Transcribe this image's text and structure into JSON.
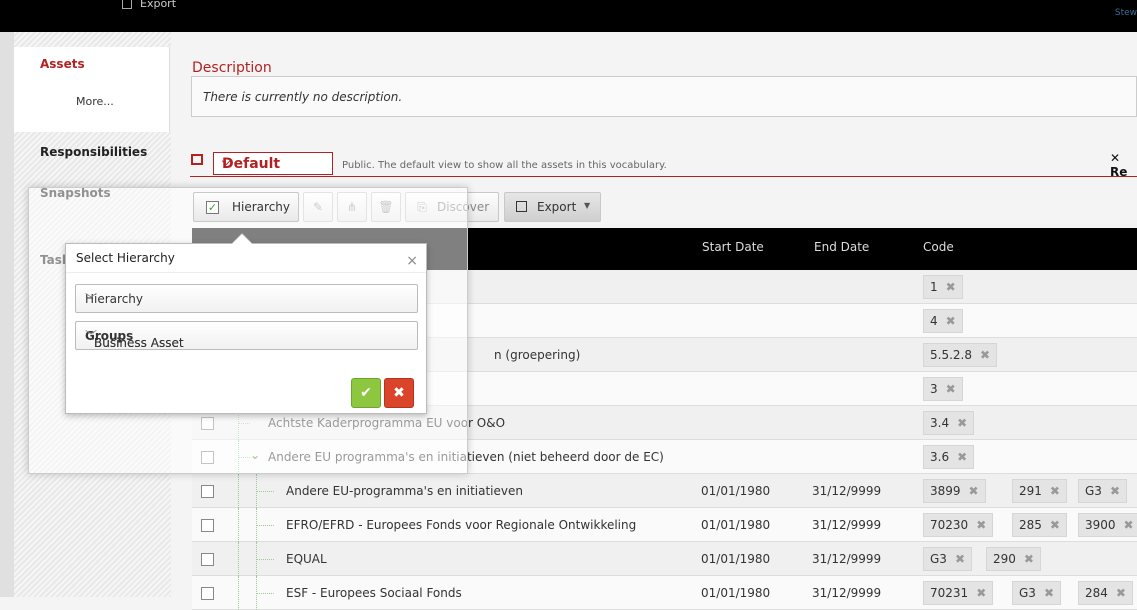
{
  "topbar": {
    "export_label": "Export",
    "user_label": "Stew"
  },
  "nav": {
    "assets": "Assets",
    "more": "More...",
    "responsibilities": "Responsibilities",
    "snapshots": "Snapshots",
    "tasks": "Task"
  },
  "description": {
    "title": "Description",
    "text": "There is currently no description."
  },
  "view": {
    "selected": "Default",
    "description": "Public. The default view to show all the assets in this vocabulary.",
    "reset_label": "Re"
  },
  "toolbar": {
    "hierarchy_label": "Hierarchy",
    "discover_label": "Discover",
    "export_label": "Export"
  },
  "table": {
    "columns": {
      "start_date": "Start Date",
      "end_date": "End Date",
      "code": "Code"
    },
    "rows": [
      {
        "name": "",
        "start": "",
        "end": "",
        "codes": [
          "1"
        ]
      },
      {
        "name": "",
        "start": "",
        "end": "",
        "codes": [
          "4"
        ]
      },
      {
        "name": "n (groepering)",
        "start": "",
        "end": "",
        "codes": [
          "5.5.2.8"
        ]
      },
      {
        "name": "",
        "start": "",
        "end": "",
        "codes": [
          "3"
        ]
      },
      {
        "name": "Achtste Kaderprogramma EU voor O&O",
        "start": "",
        "end": "",
        "codes": [
          "3.4"
        ]
      },
      {
        "name": "Andere EU programma's en initiatieven (niet beheerd door de EC)",
        "start": "",
        "end": "",
        "codes": [
          "3.6"
        ]
      },
      {
        "name": "Andere EU-programma's en initiatieven",
        "start": "01/01/1980",
        "end": "31/12/9999",
        "codes": [
          "3899",
          "291",
          "G3"
        ]
      },
      {
        "name": "EFRO/EFRD - Europees Fonds voor Regionale Ontwikkeling",
        "start": "01/01/1980",
        "end": "31/12/9999",
        "codes": [
          "70230",
          "285",
          "3900"
        ]
      },
      {
        "name": "EQUAL",
        "start": "01/01/1980",
        "end": "31/12/9999",
        "codes": [
          "G3",
          "290"
        ]
      },
      {
        "name": "ESF - Europees Sociaal Fonds",
        "start": "01/01/1980",
        "end": "31/12/9999",
        "codes": [
          "70231",
          "G3",
          "284"
        ]
      }
    ]
  },
  "popup": {
    "title": "Select Hierarchy",
    "hierarchy_select": "Hierarchy",
    "relation_pre": "Business Asset ",
    "relation_bold": "Groups",
    "relation_post": " Business Asset",
    "ok_glyph": "✔",
    "cancel_glyph": "✖",
    "close_glyph": "×"
  },
  "icons": {
    "accent": "#b22222",
    "ok_color": "#8dc63f",
    "cancel_color": "#d9442b"
  }
}
